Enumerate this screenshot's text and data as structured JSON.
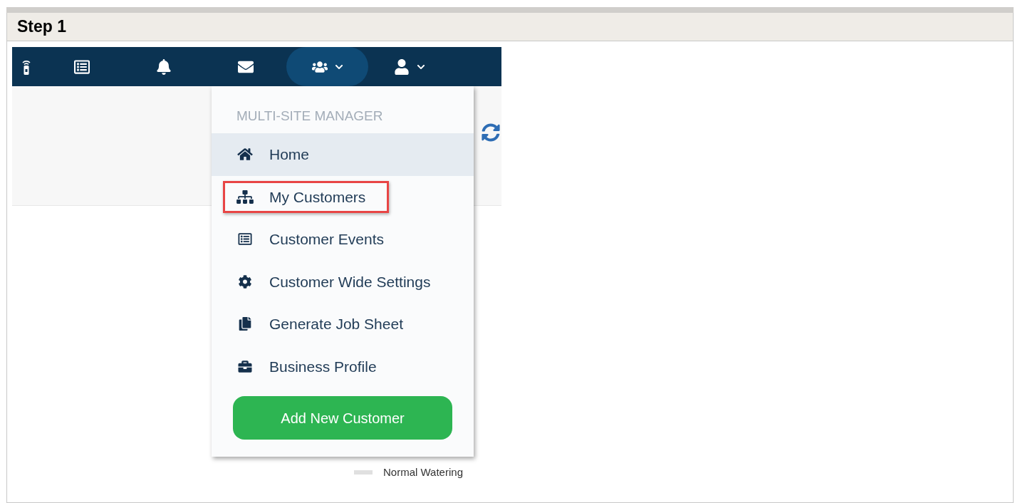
{
  "step": {
    "title": "Step 1"
  },
  "navbar": {
    "items": [
      {
        "selected": false,
        "dropdown": false
      },
      {
        "selected": false,
        "dropdown": false
      },
      {
        "selected": false,
        "dropdown": false
      },
      {
        "selected": false,
        "dropdown": false
      },
      {
        "selected": true,
        "dropdown": true
      },
      {
        "selected": false,
        "dropdown": true
      }
    ]
  },
  "dropdown_menu": {
    "heading": "MULTI-SITE MANAGER",
    "items": [
      {
        "label": "Home",
        "selected": true,
        "callout": false
      },
      {
        "label": "My Customers",
        "selected": false,
        "callout": true
      },
      {
        "label": "Customer Events",
        "selected": false,
        "callout": false
      },
      {
        "label": "Customer Wide Settings",
        "selected": false,
        "callout": false
      },
      {
        "label": "Generate Job Sheet",
        "selected": false,
        "callout": false
      },
      {
        "label": "Business Profile",
        "selected": false,
        "callout": false
      }
    ],
    "button": "Add New Customer"
  },
  "legend": {
    "items": [
      {
        "label": "Normal Watering",
        "color": "#e0e0e0"
      }
    ]
  }
}
